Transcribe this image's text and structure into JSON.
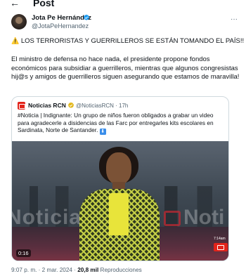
{
  "header": {
    "back_icon": "arrow-left-icon",
    "title": "Post"
  },
  "author": {
    "name": "Jota Pe Hernández",
    "handle": "@JotaPeHernandez",
    "verified_color": "#1d9bf0"
  },
  "tweet": {
    "headline": "LOS TERRORISTAS Y GUERRILLEROS SE ESTÁN TOMANDO EL PAÍS!!",
    "headline_emoji": "⚠️",
    "body": "El ministro de defensa no hace nada, el presidente propone fondos económicos para subsidiar a guerrilleros, mientras que algunos congresistas hij@s y amigos de guerrilleros siguen asegurando que estamos de maravilla!"
  },
  "quote": {
    "name": "Noticias RCN",
    "handle": "@NoticiasRCN · 17h",
    "text": "#Noticia | Indignante: Un grupo de niños fueron obligados a grabar un video para agradecerle a disidencias de las Farc por entregarles kits escolares en Sardinata, Norte de Santander.",
    "text_icon": "⬇",
    "video": {
      "duration": "0:16",
      "watermark_left": "Noticias",
      "watermark_right": "Noti",
      "live_time": "7:14am"
    }
  },
  "meta": {
    "time": "9:07 p. m. · 2 mar. 2024 ·",
    "views": "20,8 mil",
    "views_label": "Reproducciones"
  },
  "colors": {
    "accent": "#1d9bf0",
    "brand_red": "#e2231a"
  }
}
